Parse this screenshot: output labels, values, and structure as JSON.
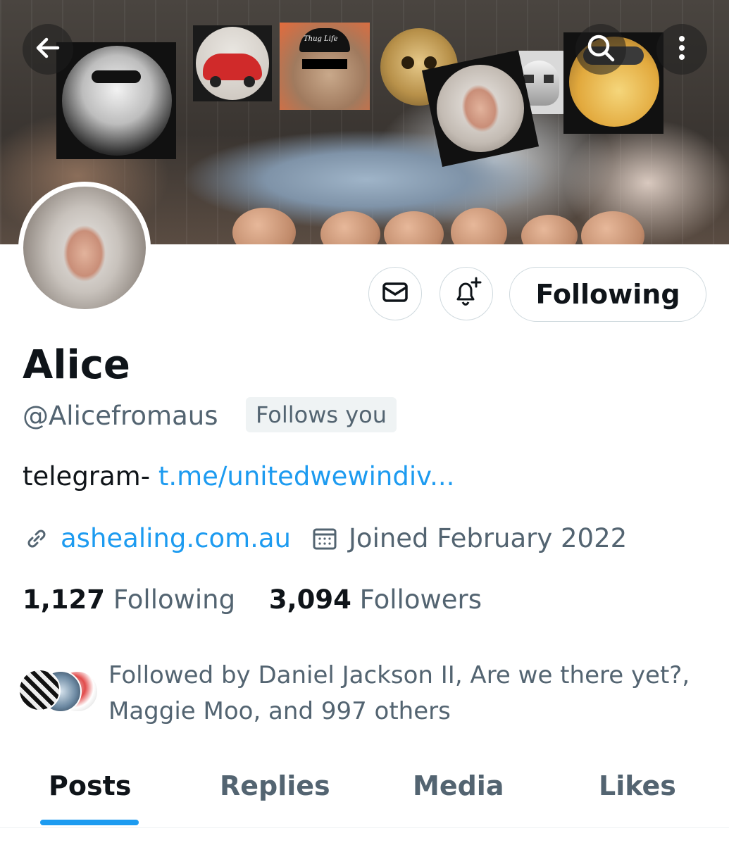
{
  "header": {
    "back_icon": "arrow-left-icon",
    "search_icon": "search-icon",
    "more_icon": "more-vertical-icon"
  },
  "banner": {
    "cap_text": "Thug Life"
  },
  "profile": {
    "name": "Alice",
    "handle": "@Alicefromaus",
    "follows_you": "Follows you",
    "bio_prefix": "telegram-",
    "bio_link": "t.me/unitedwewindiv...",
    "website": "ashealing.com.au",
    "joined": "Joined February 2022",
    "following_count": "1,127",
    "following_label": "Following",
    "followers_count": "3,094",
    "followers_label": "Followers",
    "followed_by": "Followed by Daniel Jackson II, Are we there yet?, Maggie Moo, and 997 others"
  },
  "actions": {
    "message_icon": "envelope-icon",
    "notify_icon": "bell-plus-icon",
    "follow_label": "Following"
  },
  "tabs": [
    {
      "label": "Posts",
      "active": true
    },
    {
      "label": "Replies",
      "active": false
    },
    {
      "label": "Media",
      "active": false
    },
    {
      "label": "Likes",
      "active": false
    }
  ],
  "colors": {
    "accent": "#1d9bf0",
    "text_primary": "#0f1419",
    "text_secondary": "#536471",
    "border": "#cfd9de"
  }
}
